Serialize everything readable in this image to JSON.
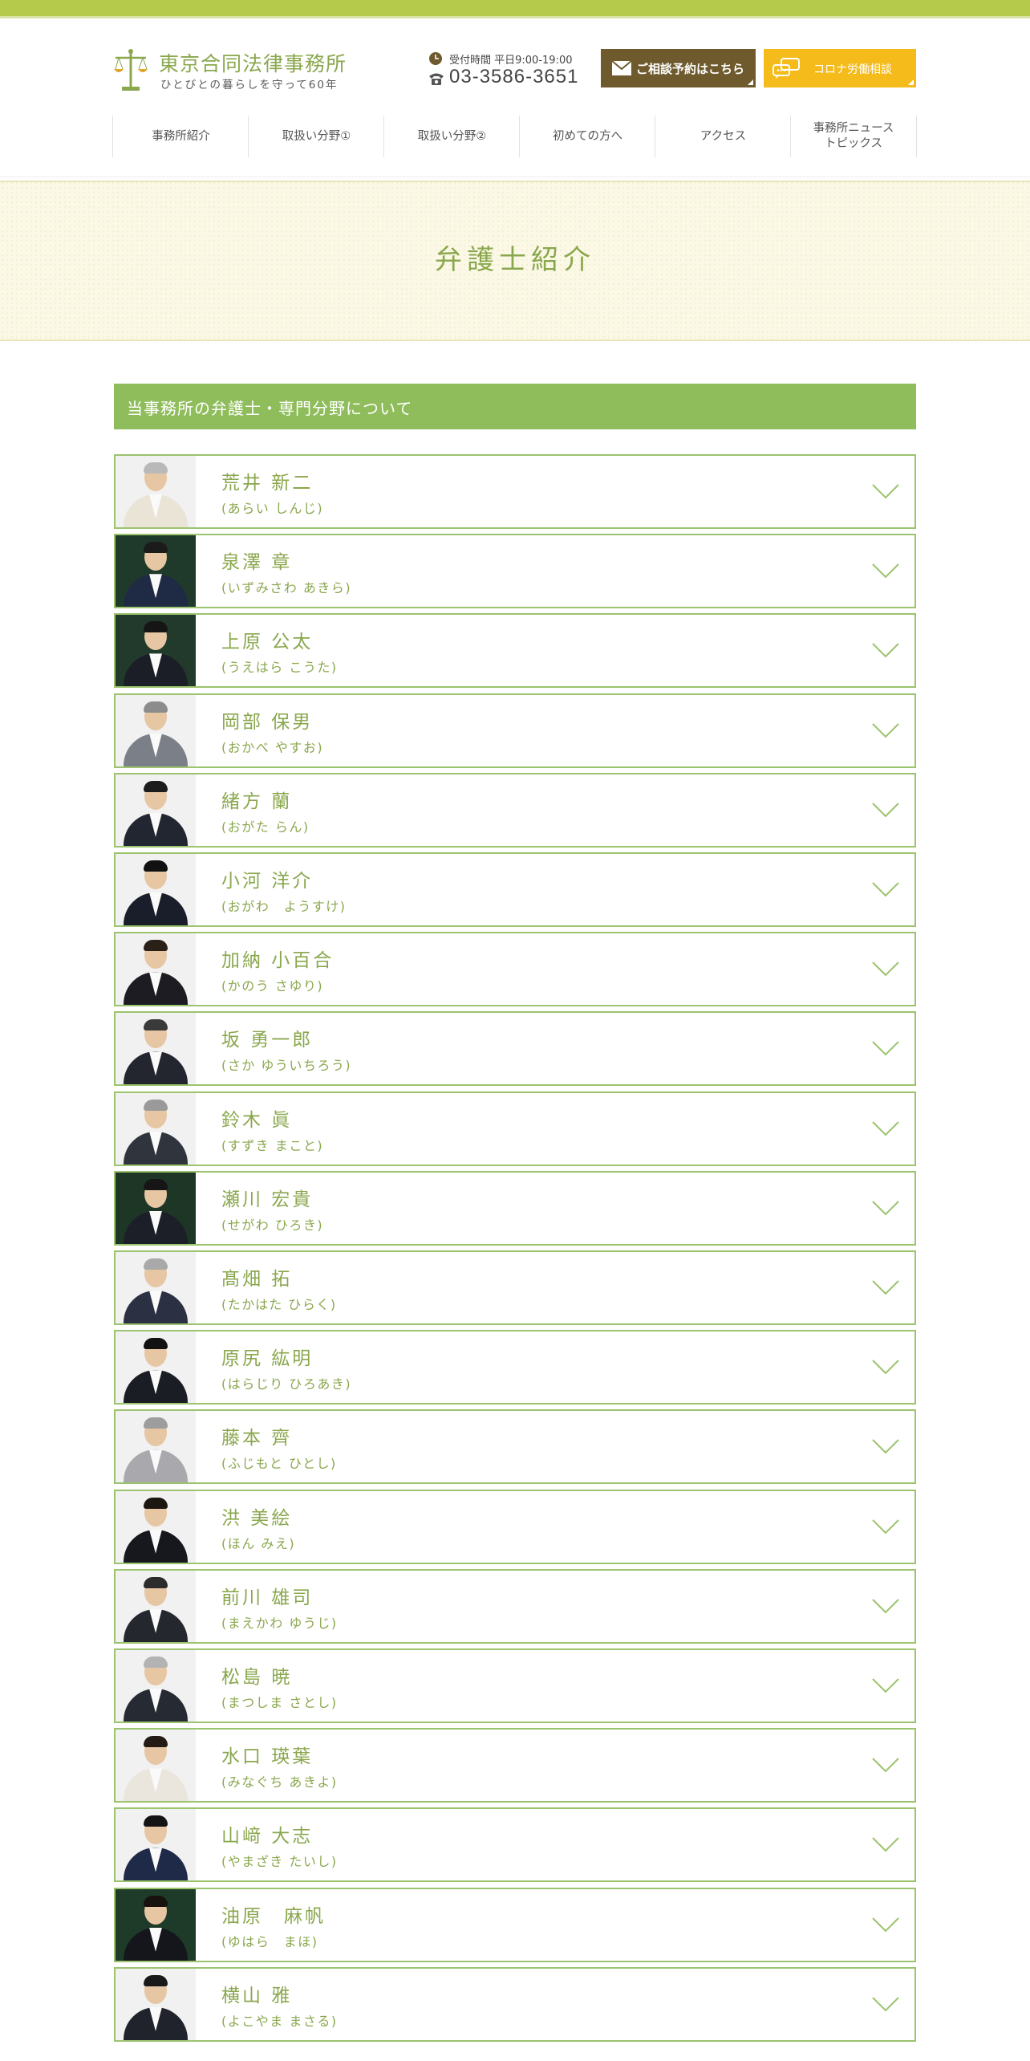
{
  "header": {
    "logo_name": "東京合同法律事務所",
    "logo_tagline": "ひとびとの暮らしを守って60年",
    "hours_label": "受付時間 平日9:00-19:00",
    "phone": "03-3586-3651",
    "reserve_button": "ご相談予約はこちら",
    "corona_button": "コロナ労働相談"
  },
  "nav": {
    "items": [
      {
        "label": "事務所紹介"
      },
      {
        "label": "取扱い分野①"
      },
      {
        "label": "取扱い分野②"
      },
      {
        "label": "初めての方へ"
      },
      {
        "label": "アクセス"
      },
      {
        "label": "事務所ニュース\nトピックス"
      }
    ]
  },
  "page": {
    "title": "弁護士紹介",
    "section_heading": "当事務所の弁護士・専門分野について"
  },
  "lawyers": [
    {
      "name": "荒井 新二",
      "kana": "(あらい しんじ)",
      "bg": "#f1f1f1",
      "hair": "#b9b9b9",
      "suit": "#e9e4d6"
    },
    {
      "name": "泉澤 章",
      "kana": "(いずみさわ あきら)",
      "bg": "#1f3a2a",
      "hair": "#1b1b1b",
      "suit": "#1f2a44"
    },
    {
      "name": "上原 公太",
      "kana": "(うえはら こうた)",
      "bg": "#213a2c",
      "hair": "#151515",
      "suit": "#1b1e26"
    },
    {
      "name": "岡部 保男",
      "kana": "(おかべ やすお)",
      "bg": "#f1f1f1",
      "hair": "#8c8c8c",
      "suit": "#7b7f88"
    },
    {
      "name": "緒方 蘭",
      "kana": "(おがた らん)",
      "bg": "#f1f1f1",
      "hair": "#1c1c1c",
      "suit": "#222630"
    },
    {
      "name": "小河 洋介",
      "kana": "(おがわ　ようすけ)",
      "bg": "#f1f1f1",
      "hair": "#111111",
      "suit": "#1a1e2a"
    },
    {
      "name": "加納 小百合",
      "kana": "(かのう さゆり)",
      "bg": "#f1f1f1",
      "hair": "#2a2018",
      "suit": "#1c1c22"
    },
    {
      "name": "坂 勇一郎",
      "kana": "(さか ゆういちろう)",
      "bg": "#f1f1f1",
      "hair": "#3a3a3a",
      "suit": "#23262e"
    },
    {
      "name": "鈴木 眞",
      "kana": "(すずき まこと)",
      "bg": "#f1f1f1",
      "hair": "#9a9a9a",
      "suit": "#30343c"
    },
    {
      "name": "瀬川 宏貴",
      "kana": "(せがわ ひろき)",
      "bg": "#1d3626",
      "hair": "#161616",
      "suit": "#1c1f28"
    },
    {
      "name": "髙畑 拓",
      "kana": "(たかはた ひらく)",
      "bg": "#f1f1f1",
      "hair": "#a9a9a9",
      "suit": "#2b3142"
    },
    {
      "name": "原尻 紘明",
      "kana": "(はらじり ひろあき)",
      "bg": "#f1f1f1",
      "hair": "#121212",
      "suit": "#1b1d24"
    },
    {
      "name": "藤本 齊",
      "kana": "(ふじもと ひとし)",
      "bg": "#f1f1f1",
      "hair": "#9d9d9d",
      "suit": "#a9a9ad"
    },
    {
      "name": "洪 美絵",
      "kana": "(ほん みえ)",
      "bg": "#f1f1f1",
      "hair": "#1d1712",
      "suit": "#16181e"
    },
    {
      "name": "前川 雄司",
      "kana": "(まえかわ ゆうじ)",
      "bg": "#f1f1f1",
      "hair": "#2c2c2c",
      "suit": "#25272e"
    },
    {
      "name": "松島 暁",
      "kana": "(まつしま さとし)",
      "bg": "#f1f1f1",
      "hair": "#b3b3b3",
      "suit": "#262a32"
    },
    {
      "name": "水口 瑛葉",
      "kana": "(みなぐち あきよ)",
      "bg": "#f1f1f1",
      "hair": "#241b14",
      "suit": "#eae6de"
    },
    {
      "name": "山﨑 大志",
      "kana": "(やまざき たいし)",
      "bg": "#f1f1f1",
      "hair": "#141414",
      "suit": "#1e2a48"
    },
    {
      "name": "油原　麻帆",
      "kana": "(ゆはら　まほ)",
      "bg": "#1e3a28",
      "hair": "#18120e",
      "suit": "#14161c"
    },
    {
      "name": "横山 雅",
      "kana": "(よこやま まさる)",
      "bg": "#f1f1f1",
      "hair": "#1a1a1a",
      "suit": "#20232c"
    }
  ],
  "colors": {
    "accent": "#8aa74d",
    "section_bg": "#8fbd5b",
    "row_border": "#9cc36d",
    "top_bar": "#b5c94a",
    "reserve_bg": "#6e5a2c",
    "corona_bg": "#f5bb1a"
  }
}
